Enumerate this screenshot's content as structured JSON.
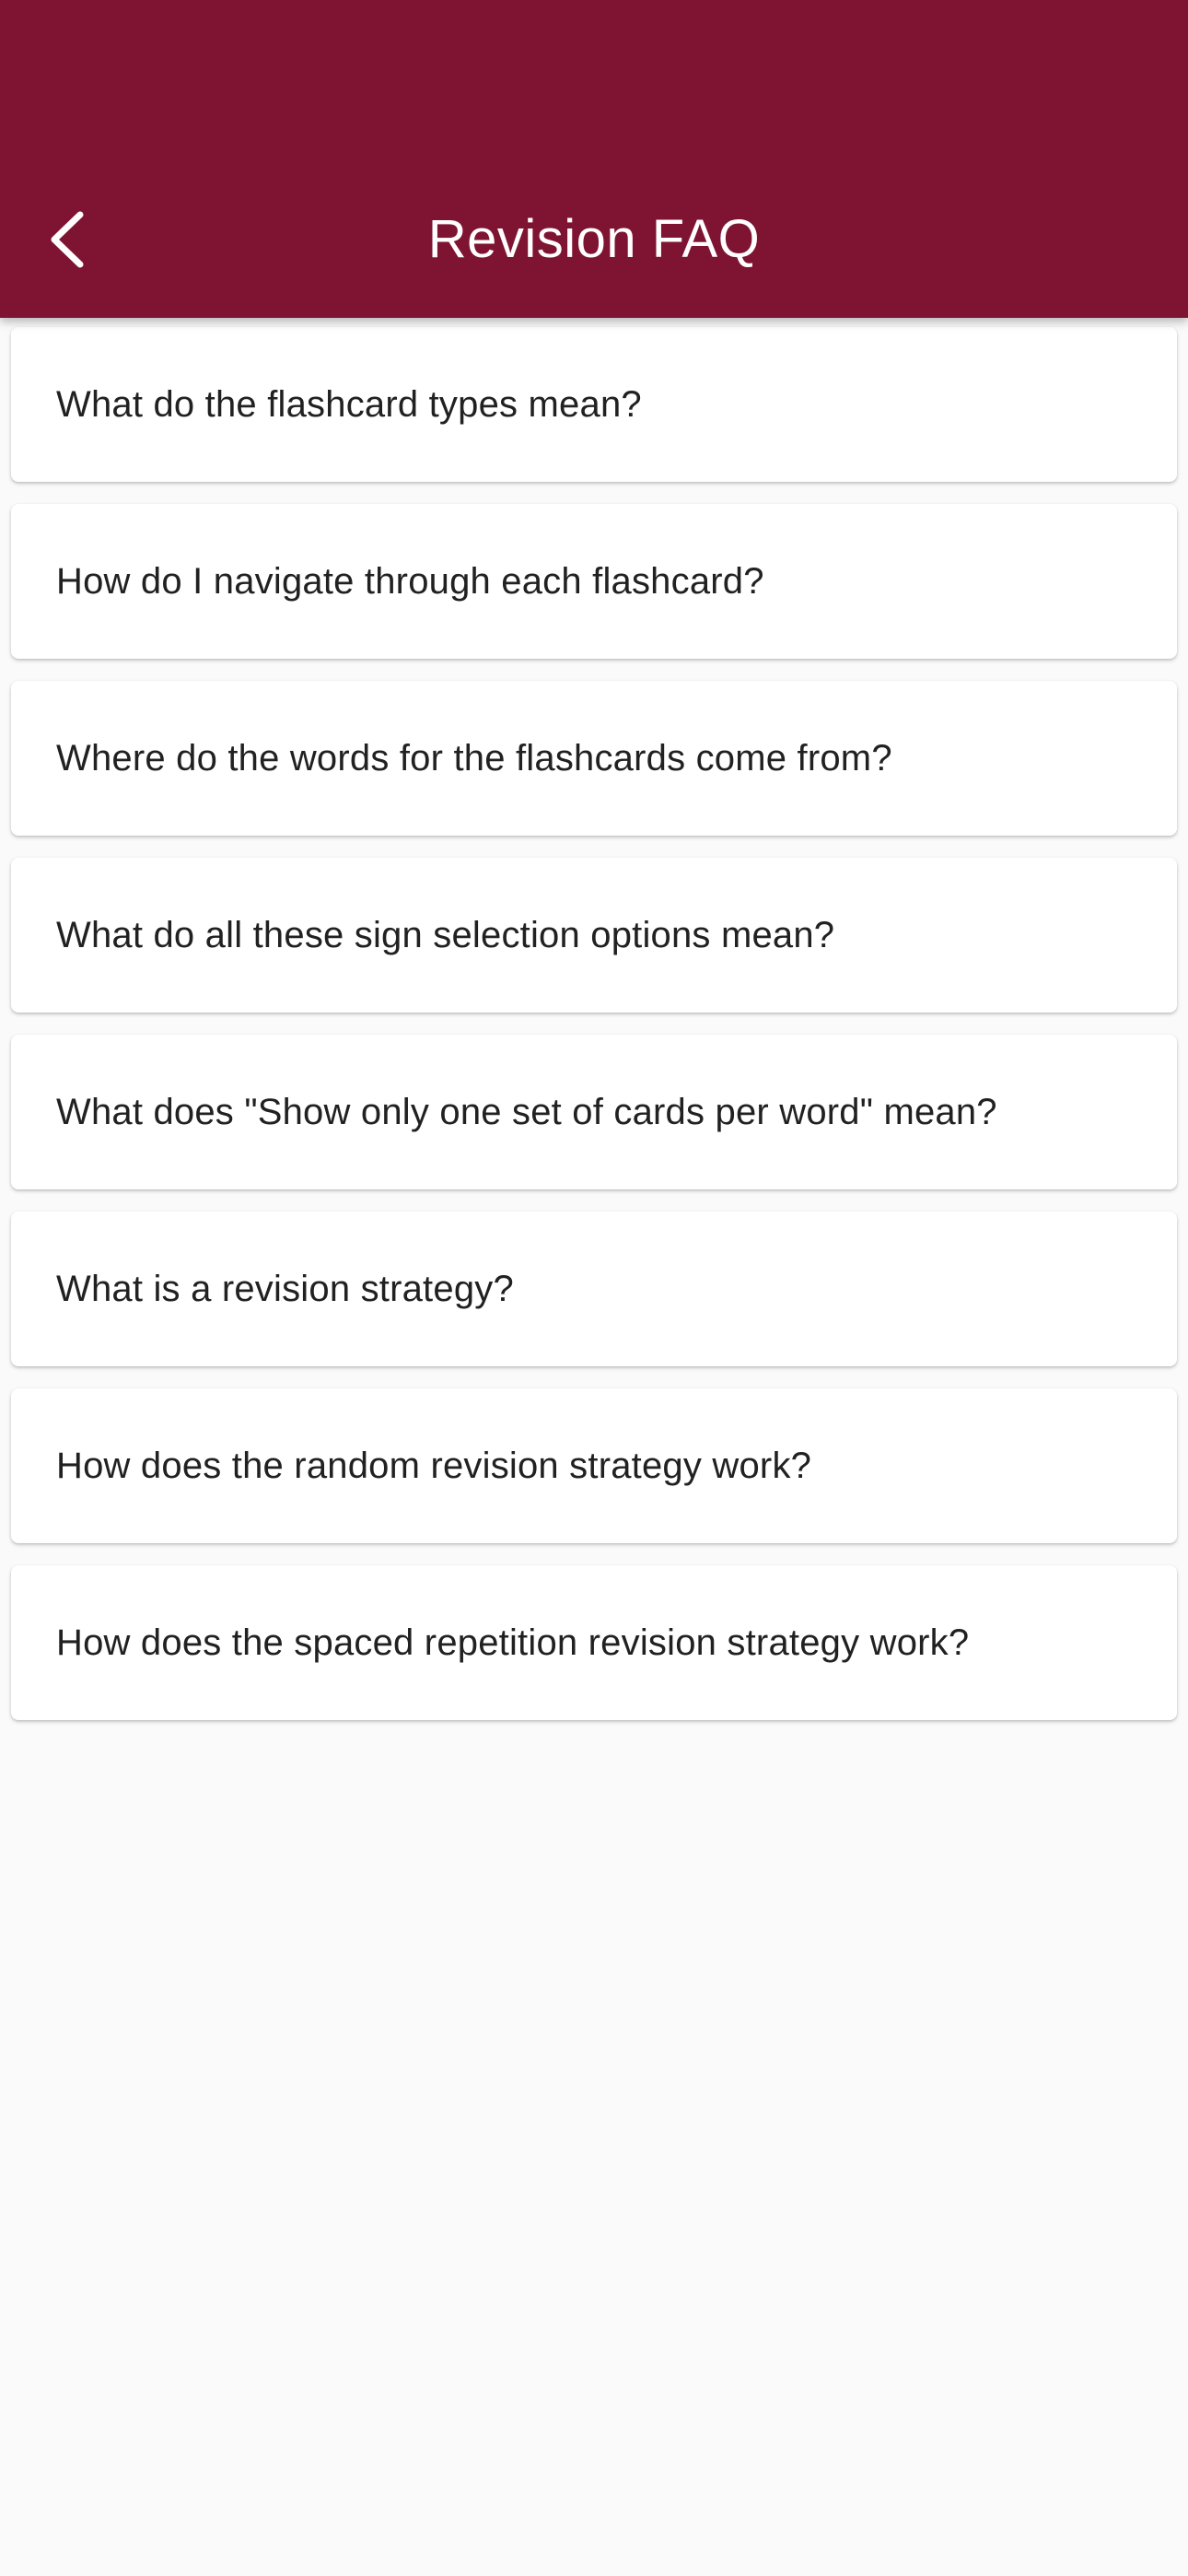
{
  "header": {
    "title": "Revision FAQ",
    "back_icon": "chevron-left-icon",
    "background_color": "#7f1432",
    "text_color": "#ffffff"
  },
  "faq": {
    "items": [
      {
        "question": "What do the flashcard types mean?"
      },
      {
        "question": "How do I navigate through each flashcard?"
      },
      {
        "question": "Where do the words for the flashcards come from?"
      },
      {
        "question": "What do all these sign selection options mean?"
      },
      {
        "question": "What does \"Show only one set of cards per word\" mean?"
      },
      {
        "question": "What is a revision strategy?"
      },
      {
        "question": "How does the random revision strategy work?"
      },
      {
        "question": "How does the spaced repetition revision strategy work?"
      }
    ]
  }
}
